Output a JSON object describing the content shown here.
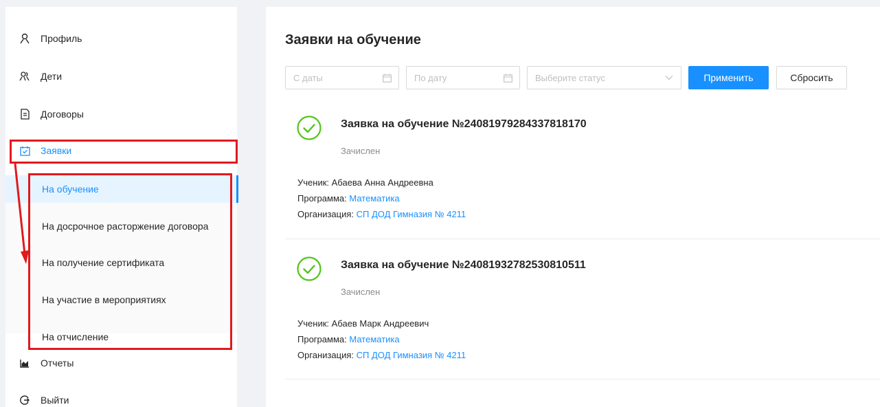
{
  "sidebar": {
    "items": [
      {
        "label": "Профиль",
        "icon": "user-icon"
      },
      {
        "label": "Дети",
        "icon": "users-icon"
      },
      {
        "label": "Договоры",
        "icon": "document-icon"
      },
      {
        "label": "Заявки",
        "icon": "calendar-check-icon"
      },
      {
        "label": "Отчеты",
        "icon": "area-chart-icon"
      },
      {
        "label": "Выйти",
        "icon": "logout-icon"
      }
    ],
    "submenu": [
      {
        "label": "На обучение",
        "selected": true
      },
      {
        "label": "На досрочное расторжение договора",
        "selected": false
      },
      {
        "label": "На получение сертификата",
        "selected": false
      },
      {
        "label": "На участие в мероприятиях",
        "selected": false
      },
      {
        "label": "На отчисление",
        "selected": false
      }
    ]
  },
  "main": {
    "title": "Заявки на обучение",
    "filters": {
      "from_date_placeholder": "С даты",
      "to_date_placeholder": "По дату",
      "status_placeholder": "Выберите статус",
      "apply_label": "Применить",
      "reset_label": "Сбросить"
    },
    "applications": [
      {
        "title": "Заявка на обучение №24081979284337818170",
        "status": "Зачислен",
        "student_label": "Ученик:",
        "student": "Абаева Анна Андреевна",
        "program_label": "Программа:",
        "program": "Математика",
        "organization_label": "Организация:",
        "organization": "СП ДОД Гимназия № 4211"
      },
      {
        "title": "Заявка на обучение №24081932782530810511",
        "status": "Зачислен",
        "student_label": "Ученик:",
        "student": "Абаев Марк Андреевич",
        "program_label": "Программа:",
        "program": "Математика",
        "organization_label": "Организация:",
        "organization": "СП ДОД Гимназия № 4211"
      }
    ]
  },
  "colors": {
    "accent": "#1890ff",
    "success": "#52c41a",
    "annotation": "#e0191e",
    "page_bg": "#f0f2f5"
  }
}
